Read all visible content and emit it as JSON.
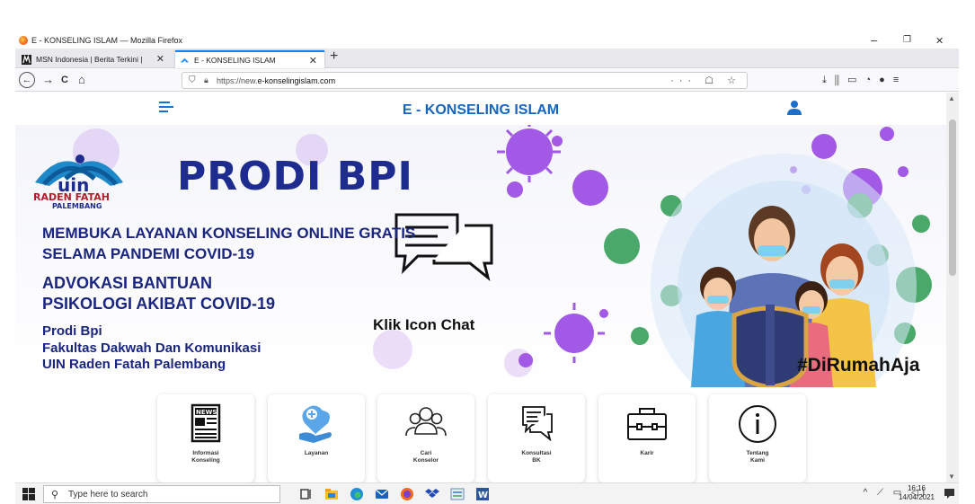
{
  "window": {
    "title": "E - KONSELING ISLAM — Mozilla Firefox",
    "minimize": "–",
    "restore": "❐",
    "close": "✕"
  },
  "tabs": [
    {
      "label": "MSN Indonesia | Berita Terkini | ",
      "close": "✕",
      "active": false
    },
    {
      "label": "E - KONSELING ISLAM",
      "close": "✕",
      "active": true
    }
  ],
  "new_tab": "+",
  "navigation": {
    "back": "←",
    "forward": "→",
    "reload": "C",
    "home": "⌂",
    "url_prefix": "https://new.",
    "url_domain": "e-konselingislam.com",
    "page_actions": "··· ☖ ☆",
    "toolbar_right": "⤓  ⫼  ▭  ◔  ●  ≡"
  },
  "site": {
    "title": "E - KONSELING ISLAM",
    "menu_icon": "hamburger-icon",
    "user_icon": "user-icon"
  },
  "hero": {
    "logo_mark": "uin",
    "logo_name": "RADEN FATAH",
    "logo_sub": "PALEMBANG",
    "heading": "PRODI BPI",
    "line1": "MEMBUKA LAYANAN KONSELING ONLINE GRATIS",
    "line2": "SELAMA PANDEMI COVID-19",
    "line3": "ADVOKASI BANTUAN",
    "line4": "PSIKOLOGI AKIBAT COVID-19",
    "line5": "Prodi Bpi",
    "line6": "Fakultas Dakwah Dan Komunikasi",
    "line7": "UIN Raden Fatah Palembang",
    "chat_label": "Klik Icon Chat",
    "hashtag": "#DiRumahAja",
    "colors": {
      "brand_blue": "#1e2c8f",
      "virus_purple": "#9c4dde",
      "virus_green": "#3fa55a"
    }
  },
  "services": [
    {
      "label": "Informasi\nKonseling",
      "icon": "newspaper-icon"
    },
    {
      "label": "Layanan",
      "icon": "care-hand-icon"
    },
    {
      "label": "Cari\nKonselor",
      "icon": "people-group-icon"
    },
    {
      "label": "Konsultasi\nBK",
      "icon": "chat-bubbles-icon"
    },
    {
      "label": "Karir",
      "icon": "briefcase-icon"
    },
    {
      "label": "Tentang\nKami",
      "icon": "info-icon"
    }
  ],
  "taskbar": {
    "search_placeholder": "Type here to search",
    "tray_icons": "^ ⟋ ▭ ◁)",
    "time": "16:16",
    "date": "14/04/2021"
  }
}
